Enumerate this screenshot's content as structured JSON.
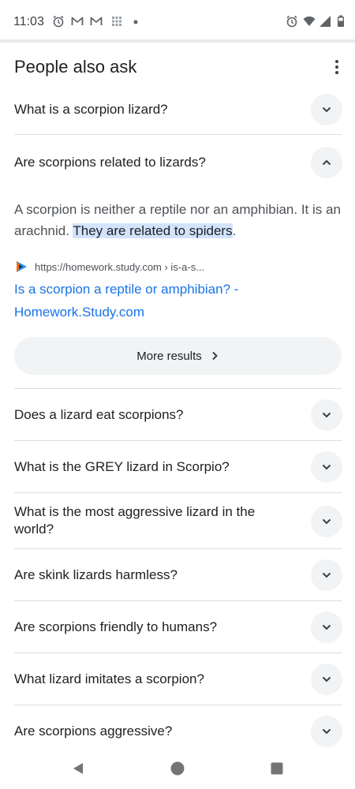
{
  "status_bar": {
    "time": "11:03",
    "left_icons": [
      "alarm-icon",
      "gmail-icon",
      "gmail-icon",
      "grid-dots-icon",
      "dot-icon"
    ],
    "right_icons": [
      "alarm-icon",
      "wifi-icon",
      "cell-signal-icon",
      "battery-icon"
    ]
  },
  "header": {
    "title": "People also ask"
  },
  "questions": [
    {
      "text": "What is a scorpion lizard?",
      "expanded": false
    },
    {
      "text": "Are scorpions related to lizards?",
      "expanded": true
    },
    {
      "text": "Does a lizard eat scorpions?",
      "expanded": false
    },
    {
      "text": "What is the GREY lizard in Scorpio?",
      "expanded": false
    },
    {
      "text": "What is the most aggressive lizard in the world?",
      "expanded": false
    },
    {
      "text": "Are skink lizards harmless?",
      "expanded": false
    },
    {
      "text": "Are scorpions friendly to humans?",
      "expanded": false
    },
    {
      "text": "What lizard imitates a scorpion?",
      "expanded": false
    },
    {
      "text": "Are scorpions aggressive?",
      "expanded": false
    }
  ],
  "answer": {
    "text_before": "A scorpion is neither a reptile nor an amphibian. It is an arachnid. ",
    "highlight": "They are related to spiders",
    "text_after": ".",
    "source_url": "https://homework.study.com › is-a-s...",
    "source_title": "Is a scorpion a reptile or amphibian? - Homework.Study.com",
    "source_icon": "study-com-favicon"
  },
  "more_results": {
    "label": "More results"
  },
  "colors": {
    "link": "#1a73e8",
    "highlight": "#d2e3fc",
    "toggle_bg": "#f1f3f4"
  }
}
